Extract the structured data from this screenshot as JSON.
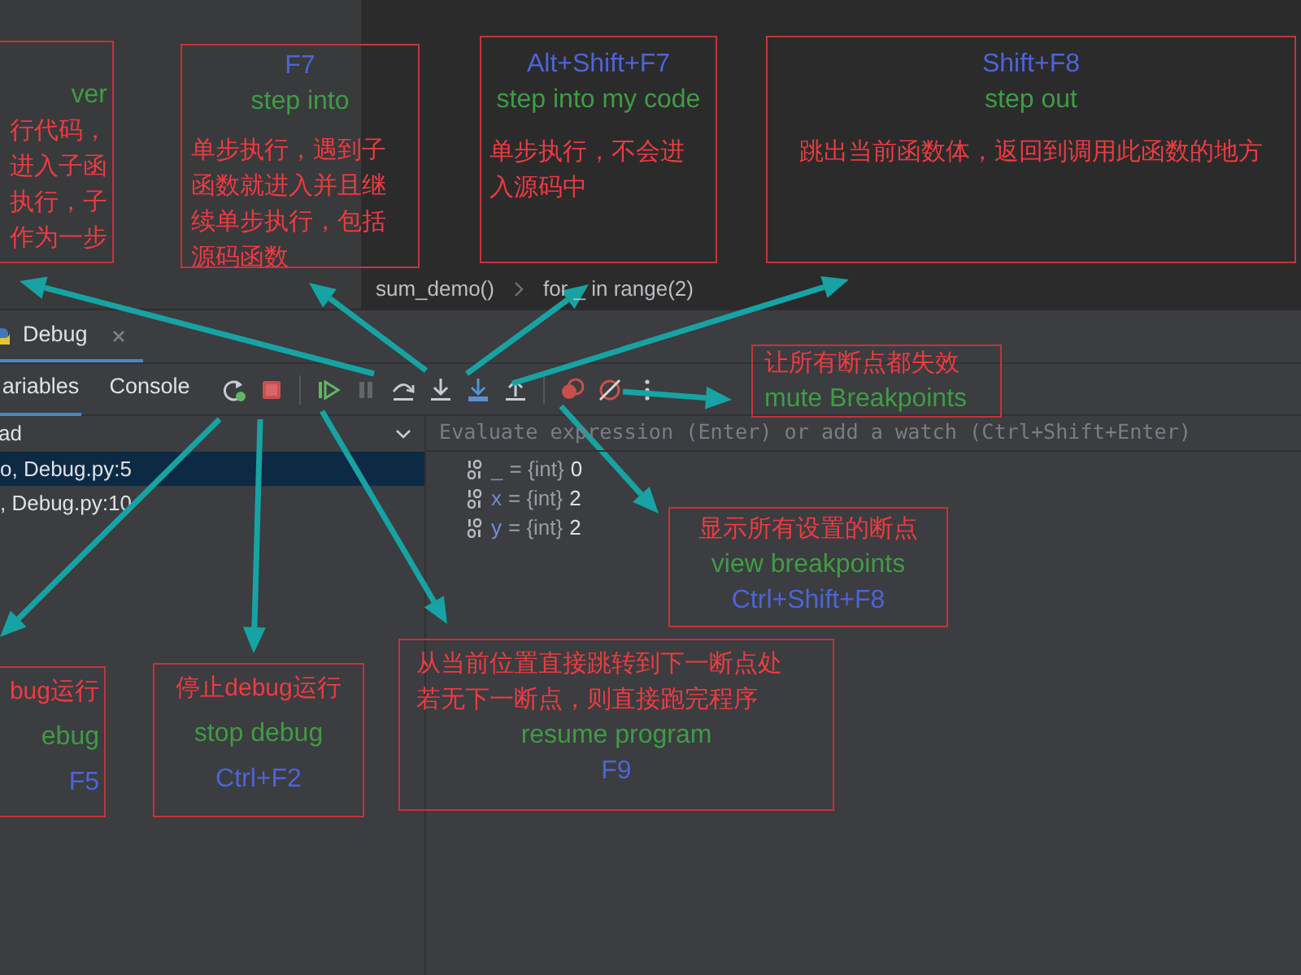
{
  "breadcrumbs": [
    "sum_demo()",
    "for _ in range(2)"
  ],
  "debug_tab": {
    "label": "Debug",
    "selected": true
  },
  "subtabs": [
    {
      "label": "ariables",
      "selected": true
    },
    {
      "label": "Console",
      "selected": false
    }
  ],
  "toolbar": [
    {
      "kind": "rerun",
      "disabled": false
    },
    {
      "kind": "stop",
      "disabled": false
    },
    {
      "kind": "separator"
    },
    {
      "kind": "resume",
      "disabled": false
    },
    {
      "kind": "pause",
      "disabled": true
    },
    {
      "kind": "step_over",
      "disabled": false
    },
    {
      "kind": "step_into",
      "disabled": false
    },
    {
      "kind": "step_into_my_code",
      "disabled": false
    },
    {
      "kind": "step_out",
      "disabled": false
    },
    {
      "kind": "separator"
    },
    {
      "kind": "view_breakpoints",
      "disabled": false
    },
    {
      "kind": "mute_breakpoints",
      "disabled": false
    },
    {
      "kind": "more",
      "disabled": false
    }
  ],
  "thread_select": {
    "value": "ad"
  },
  "frames": [
    {
      "label": "o, Debug.py:5",
      "selected": true
    },
    {
      "label": ", Debug.py:10",
      "selected": false
    }
  ],
  "evaluate": {
    "placeholder": "Evaluate expression (Enter) or add a watch (Ctrl+Shift+Enter)"
  },
  "variables": [
    {
      "name": "_",
      "type": "= {int}",
      "value": "0"
    },
    {
      "name": "x",
      "type": "= {int}",
      "value": "2"
    },
    {
      "name": "y",
      "type": "= {int}",
      "value": "2"
    }
  ],
  "annotations": [
    {
      "lines": [
        {
          "kind": "action",
          "text": "ver"
        },
        {
          "kind": "description",
          "text": "行代码，"
        },
        {
          "kind": "description",
          "text": "进入子函"
        },
        {
          "kind": "description",
          "text": "执行，子"
        },
        {
          "kind": "description",
          "text": "作为一步"
        }
      ]
    },
    {
      "lines": [
        {
          "kind": "shortcut",
          "text": "F7"
        },
        {
          "kind": "action",
          "text": "step into"
        },
        {
          "kind": "description",
          "text": "单步执行，遇到子函数就进入并且继续单步执行，包括源码函数"
        }
      ]
    },
    {
      "lines": [
        {
          "kind": "shortcut",
          "text": "Alt+Shift+F7"
        },
        {
          "kind": "action",
          "text": "step into my code"
        },
        {
          "kind": "description",
          "text": "单步执行，不会进入源码中"
        }
      ]
    },
    {
      "lines": [
        {
          "kind": "shortcut",
          "text": "Shift+F8"
        },
        {
          "kind": "action",
          "text": "step out"
        },
        {
          "kind": "description",
          "text": "跳出当前函数体，返回到调用此函数的地方"
        }
      ]
    },
    {
      "lines": [
        {
          "kind": "description",
          "text": "让所有断点都失效"
        },
        {
          "kind": "action",
          "text": "mute Breakpoints"
        }
      ]
    },
    {
      "lines": [
        {
          "kind": "description",
          "text": "显示所有设置的断点"
        },
        {
          "kind": "action",
          "text": "view breakpoints"
        },
        {
          "kind": "shortcut",
          "text": "Ctrl+Shift+F8"
        }
      ]
    },
    {
      "lines": [
        {
          "kind": "description",
          "text": "bug运行"
        },
        {
          "kind": "action",
          "text": "ebug"
        },
        {
          "kind": "shortcut",
          "text": "F5"
        }
      ]
    },
    {
      "lines": [
        {
          "kind": "description",
          "text": "停止debug运行"
        },
        {
          "kind": "action",
          "text": "stop debug"
        },
        {
          "kind": "shortcut",
          "text": "Ctrl+F2"
        }
      ]
    },
    {
      "lines": [
        {
          "kind": "description",
          "text": "从当前位置直接跳转到下一断点处"
        },
        {
          "kind": "description",
          "text": "若无下一断点，则直接跑完程序"
        },
        {
          "kind": "action",
          "text": "resume program"
        },
        {
          "kind": "shortcut",
          "text": "F9"
        }
      ]
    }
  ]
}
